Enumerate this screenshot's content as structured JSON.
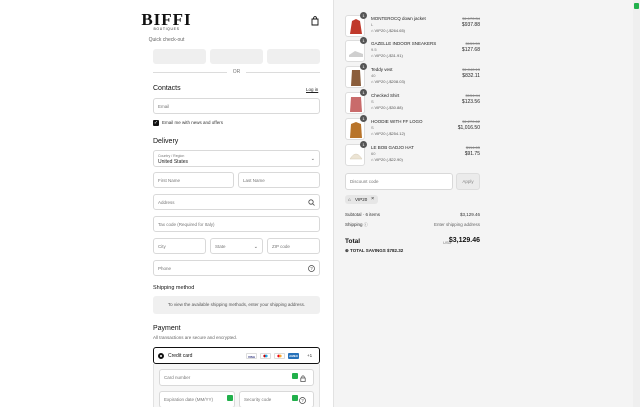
{
  "brand": {
    "name": "BIFFI",
    "sub": "BOUTIQUES"
  },
  "express": {
    "label": "Quick check-out"
  },
  "divider": {
    "or": "OR"
  },
  "contacts": {
    "title": "Contacts",
    "login": "Log in",
    "email_placeholder": "Email",
    "newsletter": "Email me with news and offers"
  },
  "delivery": {
    "title": "Delivery",
    "country_label": "Country / Region",
    "country_value": "United States",
    "first_name": "First Name",
    "last_name": "Last Name",
    "address": "Address",
    "tax": "Tax code (Required for Italy)",
    "city": "City",
    "state": "State",
    "zip": "ZIP code",
    "phone": "Phone"
  },
  "shipping": {
    "title": "Shipping method",
    "info": "To view the available shipping methods, enter your shipping address."
  },
  "payment": {
    "title": "Payment",
    "note": "All transactions are secure and encrypted.",
    "method": "Credit card",
    "more": "+1",
    "card_number": "Card number",
    "expiry": "Expiration date (MM/YY)",
    "security": "Security code",
    "logos": [
      {
        "name": "visa",
        "text": "VISA",
        "bg": "#ffffff",
        "fg": "#1a1f71"
      },
      {
        "name": "maestro",
        "text": "",
        "bg": "#ffffff",
        "fg": "#cc0000"
      },
      {
        "name": "mastercard",
        "text": "",
        "bg": "#ffffff",
        "fg": "#eb001b"
      },
      {
        "name": "amex",
        "text": "AMEX",
        "bg": "#2671b9",
        "fg": "#ffffff"
      }
    ]
  },
  "items": [
    {
      "qty": "1",
      "name": "MONTEROCQ down jacket",
      "size": "L",
      "discount": "VIP20 (-$264.65)",
      "old": "$1,170.34",
      "new": "$937.88",
      "color": "#c0392b"
    },
    {
      "qty": "1",
      "name": "GAZELLE INDOOR SNEAKERS",
      "size": "9.5",
      "discount": "VIP20 (-$31.91)",
      "old": "$159.59",
      "new": "$127.68",
      "color": "#cfcfcf"
    },
    {
      "qty": "1",
      "name": "Teddy vest",
      "size": "40",
      "discount": "VIP20 (-$208.03)",
      "old": "$1,040.13",
      "new": "$832.11",
      "color": "#8b5e3c"
    },
    {
      "qty": "1",
      "name": "Checked Shirt",
      "size": "S",
      "discount": "VIP20 (-$30.88)",
      "old": "$154.44",
      "new": "$123.56",
      "color": "#c96b6b"
    },
    {
      "qty": "1",
      "name": "HOODIE WITH FF LOGO",
      "size": "S",
      "discount": "VIP20 (-$254.12)",
      "old": "$1,270.62",
      "new": "$1,016.50",
      "color": "#b8742a"
    },
    {
      "qty": "1",
      "name": "LE BOB GADJO HAT",
      "size": "60",
      "discount": "VIP20 (-$22.90)",
      "old": "$114.65",
      "new": "$91.75",
      "color": "#ece4d4"
    }
  ],
  "discount": {
    "placeholder": "Discount code",
    "apply": "Apply",
    "chip": "VIP20"
  },
  "summary": {
    "subtotal_label": "Subtotal · 6 items",
    "subtotal_value": "$3,129.46",
    "shipping_label": "Shipping",
    "shipping_value": "Enter shipping address",
    "total_label": "Total",
    "currency": "USD",
    "total_value": "$3,129.46",
    "savings": "TOTAL SAVINGS  $782.32"
  }
}
